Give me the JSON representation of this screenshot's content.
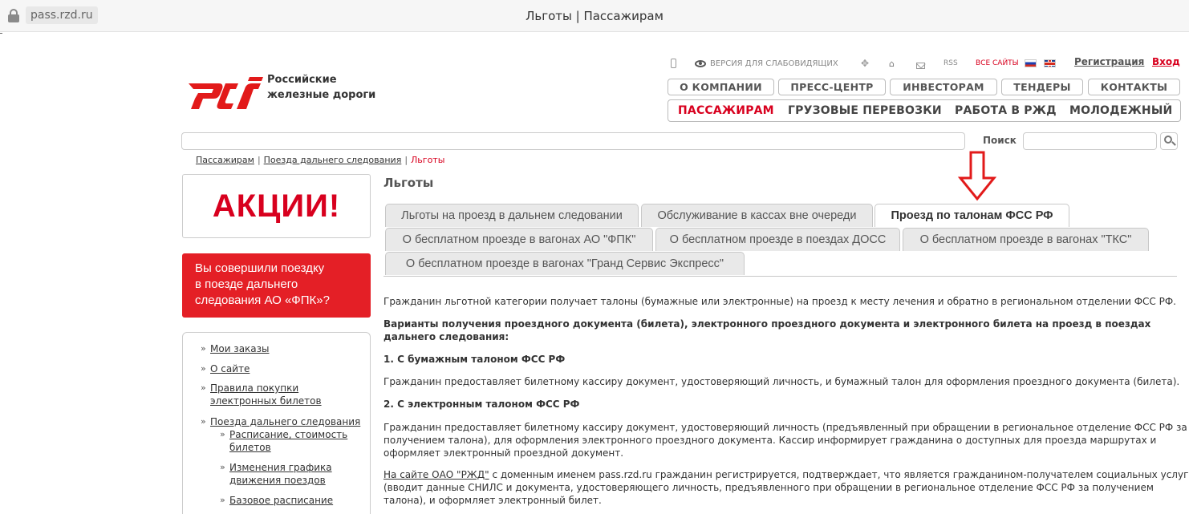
{
  "browser": {
    "url": "pass.rzd.ru",
    "window_title": "Льготы | Пассажирам"
  },
  "header": {
    "logo_text_line1": "Российские",
    "logo_text_line2": "железные дороги",
    "accessibility_label": "ВЕРСИЯ ДЛЯ СЛАБОВИДЯЩИХ",
    "rss_label": "RSS",
    "all_sites_label": "ВСЕ САЙТЫ",
    "register_link": "Регистрация",
    "login_link": "Вход",
    "brand_color": "#d8001e"
  },
  "top_nav": [
    "О КОМПАНИИ",
    "ПРЕСС-ЦЕНТР",
    "ИНВЕСТОРАМ",
    "ТЕНДЕРЫ",
    "КОНТАКТЫ"
  ],
  "main_nav": [
    "ПАССАЖИРАМ",
    "ГРУЗОВЫЕ ПЕРЕВОЗКИ",
    "РАБОТА В РЖД",
    "МОЛОДЕЖНЫЙ"
  ],
  "search": {
    "label": "Поиск",
    "value": ""
  },
  "breadcrumb": [
    "Пассажирам",
    "Поезда дальнего следования",
    "Льготы"
  ],
  "sidebar": {
    "promo_text": "АКЦИИ!",
    "banner_lines": [
      "Вы совершили поездку",
      "в поезде дальнего",
      "следования АО «ФПК»?"
    ],
    "menu": [
      {
        "line1": "Мои заказы",
        "line2": ""
      },
      {
        "line1": "О сайте",
        "line2": ""
      },
      {
        "line1": "Правила покупки",
        "line2": "электронных билетов"
      },
      {
        "line1": "Поезда дальнего следования",
        "line2": ""
      }
    ],
    "submenu": [
      {
        "line1": "Расписание, стоимость",
        "line2": "билетов"
      },
      {
        "line1": "Изменения графика",
        "line2": "движения поездов"
      },
      {
        "line1": "Базовое расписание",
        "line2": ""
      }
    ]
  },
  "content": {
    "title": "Льготы",
    "tabs": [
      "Льготы на проезд в дальнем следовании",
      "Обслуживание в кассах вне очереди",
      "Проезд по талонам ФСС РФ",
      "О бесплатном проезде в вагонах АО \"ФПК\"",
      "О бесплатном проезде в поездах ДОСС",
      "О бесплатном проезде в вагонах \"ТКС\"",
      "О бесплатном проезде в вагонах \"Гранд Сервис Экспресс\""
    ],
    "active_tab": "Проезд по талонам ФСС РФ",
    "intro": "Гражданин льготной категории получает талоны (бумажные или электронные) на проезд к месту лечения и обратно в региональном отделении ФСС РФ.",
    "variants_heading_line1": "Варианты получения проездного документа (билета), электронного проездного документа и электронного билета на проезд в поездах",
    "variants_heading_line2": "дальнего следования:",
    "section1_heading": "1. С бумажным талоном ФСС РФ",
    "section1_text": "Гражданин предоставляет билетному кассиру документ, удостоверяющий личность, и бумажный талон для оформления проездного документа (билета).",
    "section2_heading": "2. С электронным талоном ФСС РФ",
    "section2_line1": "Гражданин предоставляет билетному кассиру документ, удостоверяющий личность (предъявленный при обращении в региональное отделение ФСС РФ за",
    "section2_line2": "получением талона), для оформления электронного проездного документа. Кассир информирует гражданина о доступных для проезда маршрутах и",
    "section2_line3": "оформляет электронный проездной документ.",
    "site_link": "На сайте ОАО \"РЖД\"",
    "site_line1_rest": " с доменным именем pass.rzd.ru гражданин регистрируется, подтверждает, что является гражданином-получателем социальных услуг",
    "site_line2": "(вводит данные СНИЛС и документа, удостоверяющего личность, предъявленного при обращении в региональное отделение ФСС РФ за получением",
    "site_line3": "талона), и оформляет электронный билет."
  }
}
